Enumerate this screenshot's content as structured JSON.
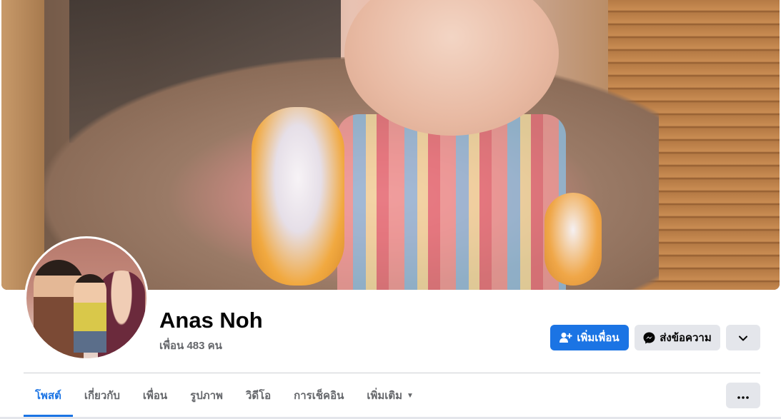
{
  "profile": {
    "name": "Anas Noh",
    "friends_text": "เพื่อน 483 คน"
  },
  "actions": {
    "add_friend_label": "เพิ่มเพื่อน",
    "message_label": "ส่งข้อความ",
    "more_icon": "chevron-down-icon"
  },
  "tabs": [
    {
      "label": "โพสต์",
      "active": true
    },
    {
      "label": "เกี่ยวกับ",
      "active": false
    },
    {
      "label": "เพื่อน",
      "active": false
    },
    {
      "label": "รูปภาพ",
      "active": false
    },
    {
      "label": "วิดีโอ",
      "active": false
    },
    {
      "label": "การเช็คอิน",
      "active": false
    },
    {
      "label": "เพิ่มเติม",
      "active": false,
      "has_dropdown": true
    }
  ],
  "colors": {
    "accent": "#1b74e4",
    "secondary_button": "#e4e6eb",
    "muted_text": "#65676b",
    "primary_text": "#050505"
  }
}
